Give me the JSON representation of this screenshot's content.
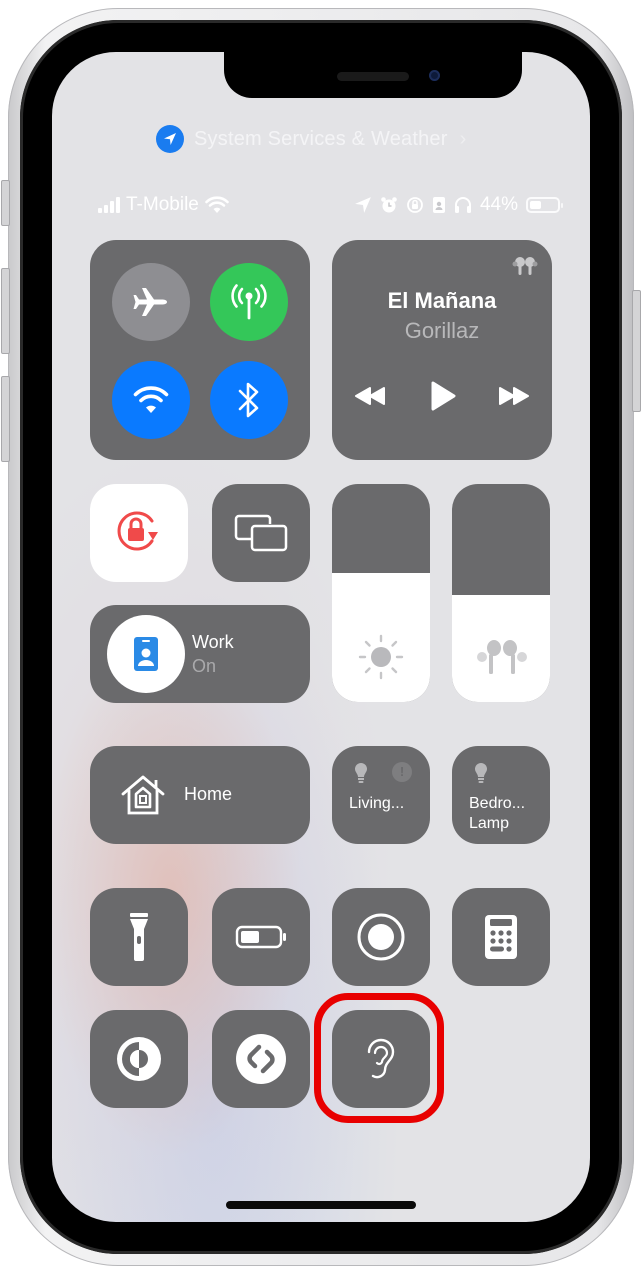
{
  "location_banner": {
    "text": "System Services & Weather",
    "icon": "location-arrow-icon",
    "chevron": "›"
  },
  "status_bar": {
    "carrier": "T-Mobile",
    "signal_bars": 4,
    "wifi": true,
    "right_icons": [
      "location-arrow-icon",
      "alarm-icon",
      "orientation-lock-icon",
      "focus-work-icon",
      "headphones-icon"
    ],
    "battery_percent": "44%",
    "battery_level": 0.44
  },
  "connectivity": {
    "airplane": {
      "label": "Airplane Mode",
      "on": false,
      "color": "#8e8e92"
    },
    "cellular": {
      "label": "Cellular Data",
      "on": true,
      "color": "#34c759"
    },
    "wifi": {
      "label": "Wi-Fi",
      "on": true,
      "color": "#0a7aff"
    },
    "bluetooth": {
      "label": "Bluetooth",
      "on": true,
      "color": "#0a7aff"
    }
  },
  "now_playing": {
    "title": "El Mañana",
    "artist": "Gorillaz",
    "output_icon": "airpods-icon",
    "controls": [
      "rewind",
      "play",
      "fast-forward"
    ]
  },
  "orientation_lock": {
    "label": "Orientation Lock",
    "on": true,
    "color": "#f04a4a"
  },
  "screen_mirroring": {
    "label": "Screen Mirroring"
  },
  "focus": {
    "title": "Work",
    "status": "On",
    "icon_color": "#2a8ae6"
  },
  "brightness": {
    "label": "Brightness",
    "level": 0.59
  },
  "volume": {
    "label": "Volume",
    "level": 0.49
  },
  "home": {
    "label": "Home"
  },
  "accessories": [
    {
      "label": "Living...",
      "alert": true
    },
    {
      "label_line1": "Bedro...",
      "label_line2": "Lamp"
    }
  ],
  "controls_row1": [
    "Flashlight",
    "Low Power Mode",
    "Screen Recording",
    "Calculator"
  ],
  "controls_row2": [
    "Dark Mode",
    "Shazam",
    "Hearing"
  ],
  "highlight": {
    "target": "Hearing",
    "color": "#e80000"
  }
}
